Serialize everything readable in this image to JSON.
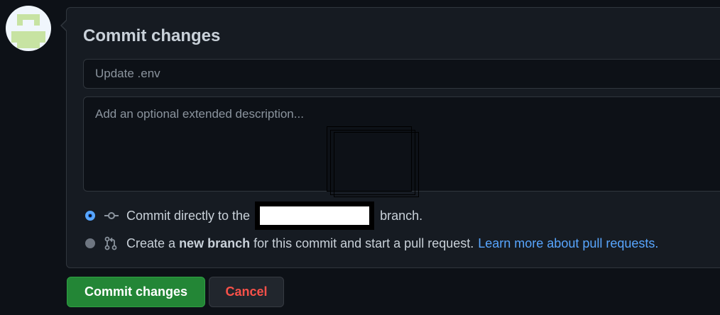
{
  "commit": {
    "title": "Commit changes",
    "summary_placeholder": "Update .env",
    "description_placeholder": "Add an optional extended description..."
  },
  "options": {
    "direct": {
      "prefix": "Commit directly to the",
      "suffix": "branch.",
      "selected": true
    },
    "new_branch": {
      "prefix": "Create a",
      "bold": "new branch",
      "suffix": "for this commit and start a pull request.",
      "link": "Learn more about pull requests.",
      "selected": false
    }
  },
  "buttons": {
    "commit": "Commit changes",
    "cancel": "Cancel"
  },
  "colors": {
    "background": "#0d1117",
    "panel": "#161b22",
    "primary_button": "#238636",
    "cancel_text": "#f85149",
    "link": "#58a6ff",
    "avatar_fill": "#c7e3a2"
  }
}
